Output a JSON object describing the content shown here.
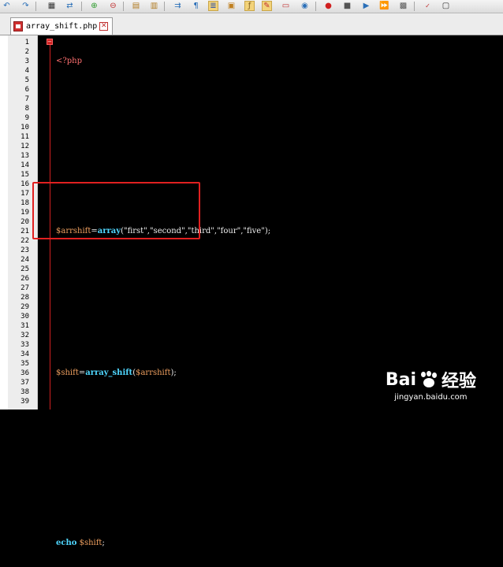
{
  "toolbar": {
    "icons": [
      "undo-icon",
      "redo-icon",
      "find-icon",
      "replace-icon",
      "zoom-in-icon",
      "zoom-out-icon",
      "sync-v-icon",
      "sync-h-icon",
      "wrap-icon",
      "show-all-chars-icon",
      "indent-guide-icon",
      "doc-map-icon",
      "function-list-icon",
      "folder-workspace-icon",
      "monitor-icon",
      "record-macro-icon",
      "stop-macro-icon",
      "play-macro-icon",
      "run-macro-multiple-icon",
      "save-macro-icon",
      "spellcheck-icon",
      "terminal-icon"
    ]
  },
  "tab": {
    "title": "array_shift.php",
    "close_symbol": "✕"
  },
  "line_numbers": [
    "1",
    "2",
    "3",
    "4",
    "5",
    "6",
    "7",
    "8",
    "9",
    "10",
    "11",
    "12",
    "13",
    "14",
    "15",
    "16",
    "17",
    "18",
    "19",
    "20",
    "21",
    "22",
    "23",
    "24",
    "25",
    "26",
    "27",
    "28",
    "29",
    "30",
    "31",
    "32",
    "33",
    "34",
    "35",
    "36",
    "37",
    "38",
    "39"
  ],
  "code": {
    "line1": "<?php",
    "line7": {
      "var": "$arrshift",
      "eq": "=",
      "func": "array",
      "args": "(\"first\",\"second\",\"third\",\"four\",\"five\");"
    },
    "line12": {
      "var": "$shift",
      "eq": "=",
      "func": "array_shift",
      "open": "(",
      "arg": "$arrshift",
      "close": ");"
    },
    "line18": {
      "kw": "echo",
      "space": " ",
      "var": "$shift",
      "end": ";"
    }
  },
  "watermark": {
    "logo_left": "Bai",
    "logo_right": "经验",
    "url": "jingyan.baidu.com"
  }
}
